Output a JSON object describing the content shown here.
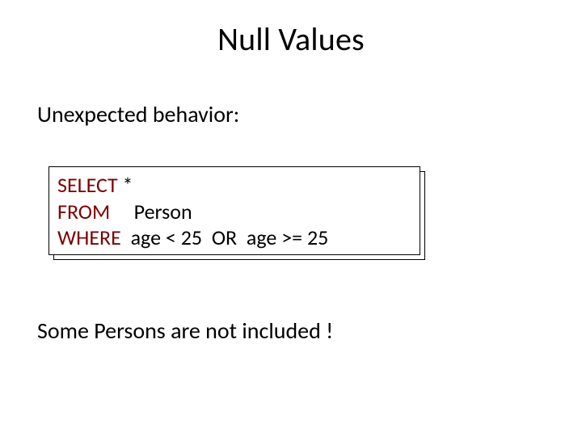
{
  "title": "Null Values",
  "subhead": "Unexpected behavior:",
  "code": {
    "kw_select": "SELECT",
    "t_select": " *",
    "kw_from": "FROM",
    "t_from": "     Person",
    "kw_where": "WHERE",
    "t_where": "  age < 25  OR  age >= 25"
  },
  "note": "Some Persons are not included !"
}
